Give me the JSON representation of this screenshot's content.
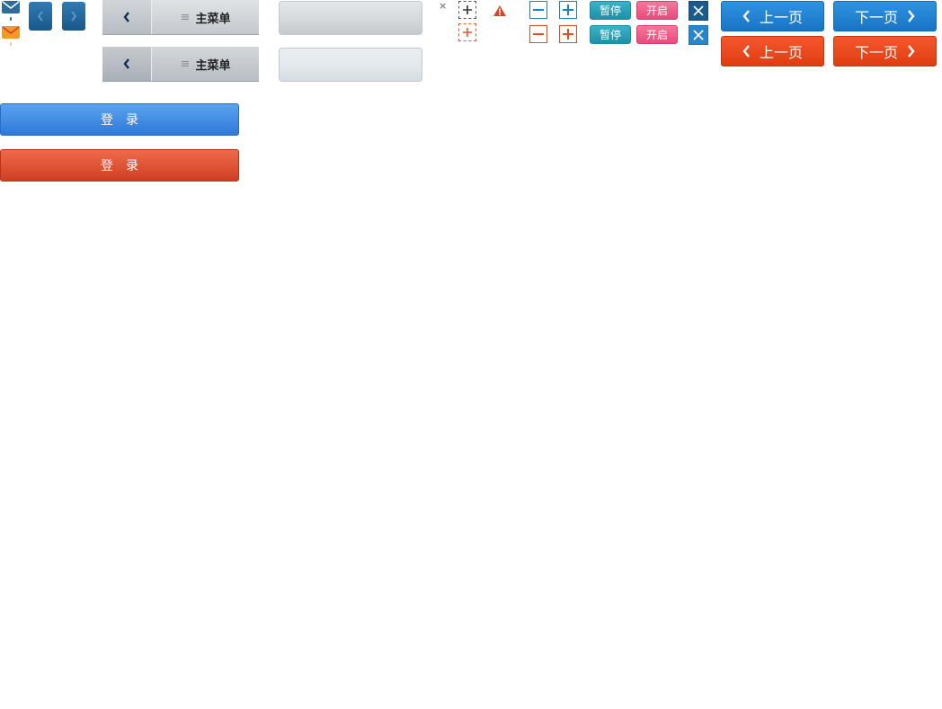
{
  "icons": {
    "mail_blue": "mail-icon",
    "mail_orange": "mail-icon",
    "prev": "chevron-left-icon",
    "next": "chevron-right-icon",
    "warning": "warning-icon",
    "close": "close-icon",
    "menu": "menu-lines-icon"
  },
  "menubar": {
    "top_label": "主菜单",
    "bottom_label": "主菜单"
  },
  "controls": {
    "close_small": "×",
    "pause_label_1": "暂停",
    "start_label_1": "开启",
    "pause_label_2": "暂停",
    "start_label_2": "开启"
  },
  "paging": {
    "prev_label_1": "上一页",
    "next_label_1": "下一页",
    "prev_label_2": "上一页",
    "next_label_2": "下一页"
  },
  "login": {
    "blue_label": "登录",
    "red_label": "登录"
  },
  "colors": {
    "blue": "#1a74c6",
    "red": "#e03c12",
    "teal": "#1e8fa6",
    "pink": "#e84a7c",
    "dark_blue": "#1a5a8d"
  }
}
